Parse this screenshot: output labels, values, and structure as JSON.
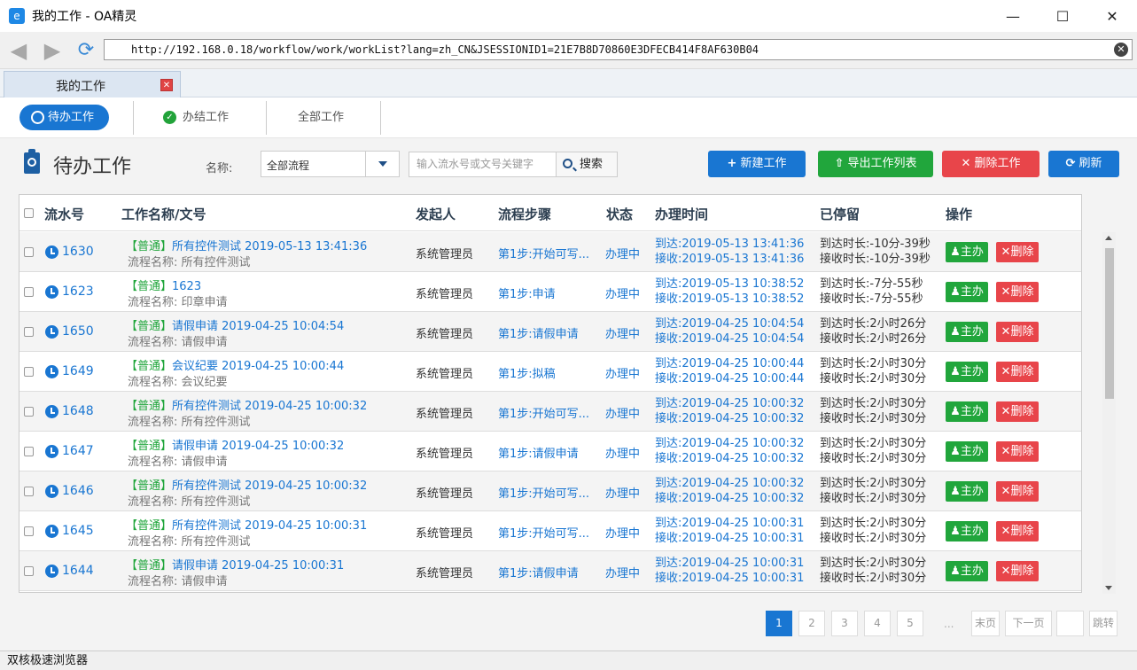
{
  "window": {
    "title": "我的工作 - OA精灵",
    "url": "http://192.168.0.18/workflow/work/workList?lang=zh_CN&JSESSIONID1=21E7B8D70860E3DFECB414F8AF630B04",
    "status_bar": "双核极速浏览器"
  },
  "doc_tab": {
    "label": "我的工作"
  },
  "subtabs": {
    "pending": "待办工作",
    "done": "办结工作",
    "all": "全部工作"
  },
  "toolbar": {
    "page_title": "待办工作",
    "name_label": "名称:",
    "flow_select_value": "全部流程",
    "search_placeholder": "输入流水号或文号关键字",
    "search_button": "搜索",
    "new_button": "新建工作",
    "export_button": "导出工作列表",
    "delete_button": "删除工作",
    "refresh_button": "刷新"
  },
  "table": {
    "headers": {
      "serial": "流水号",
      "name": "工作名称/文号",
      "sender": "发起人",
      "step": "流程步骤",
      "status": "状态",
      "time": "办理时间",
      "stay": "已停留",
      "ops": "操作"
    },
    "op_main": "主办",
    "op_delete": "删除",
    "rows": [
      {
        "num": "1630",
        "tag": "【普通】",
        "title": "所有控件测试 2019-05-13 13:41:36",
        "flow": "流程名称: 所有控件测试",
        "sender": "系统管理员",
        "step": "第1步:开始可写...",
        "status": "办理中",
        "arrive": "到达:2019-05-13 13:41:36",
        "receive": "接收:2019-05-13 13:41:36",
        "stay_arrive": "到达时长:-10分-39秒",
        "stay_receive": "接收时长:-10分-39秒"
      },
      {
        "num": "1623",
        "tag": "【普通】",
        "title": "1623",
        "flow": "流程名称: 印章申请",
        "sender": "系统管理员",
        "step": "第1步:申请",
        "status": "办理中",
        "arrive": "到达:2019-05-13 10:38:52",
        "receive": "接收:2019-05-13 10:38:52",
        "stay_arrive": "到达时长:-7分-55秒",
        "stay_receive": "接收时长:-7分-55秒"
      },
      {
        "num": "1650",
        "tag": "【普通】",
        "title": "请假申请 2019-04-25 10:04:54",
        "flow": "流程名称: 请假申请",
        "sender": "系统管理员",
        "step": "第1步:请假申请",
        "status": "办理中",
        "arrive": "到达:2019-04-25 10:04:54",
        "receive": "接收:2019-04-25 10:04:54",
        "stay_arrive": "到达时长:2小时26分",
        "stay_receive": "接收时长:2小时26分"
      },
      {
        "num": "1649",
        "tag": "【普通】",
        "title": "会议纪要 2019-04-25 10:00:44",
        "flow": "流程名称: 会议纪要",
        "sender": "系统管理员",
        "step": "第1步:拟稿",
        "status": "办理中",
        "arrive": "到达:2019-04-25 10:00:44",
        "receive": "接收:2019-04-25 10:00:44",
        "stay_arrive": "到达时长:2小时30分",
        "stay_receive": "接收时长:2小时30分"
      },
      {
        "num": "1648",
        "tag": "【普通】",
        "title": "所有控件测试 2019-04-25 10:00:32",
        "flow": "流程名称: 所有控件测试",
        "sender": "系统管理员",
        "step": "第1步:开始可写...",
        "status": "办理中",
        "arrive": "到达:2019-04-25 10:00:32",
        "receive": "接收:2019-04-25 10:00:32",
        "stay_arrive": "到达时长:2小时30分",
        "stay_receive": "接收时长:2小时30分"
      },
      {
        "num": "1647",
        "tag": "【普通】",
        "title": "请假申请 2019-04-25 10:00:32",
        "flow": "流程名称: 请假申请",
        "sender": "系统管理员",
        "step": "第1步:请假申请",
        "status": "办理中",
        "arrive": "到达:2019-04-25 10:00:32",
        "receive": "接收:2019-04-25 10:00:32",
        "stay_arrive": "到达时长:2小时30分",
        "stay_receive": "接收时长:2小时30分"
      },
      {
        "num": "1646",
        "tag": "【普通】",
        "title": "所有控件测试 2019-04-25 10:00:32",
        "flow": "流程名称: 所有控件测试",
        "sender": "系统管理员",
        "step": "第1步:开始可写...",
        "status": "办理中",
        "arrive": "到达:2019-04-25 10:00:32",
        "receive": "接收:2019-04-25 10:00:32",
        "stay_arrive": "到达时长:2小时30分",
        "stay_receive": "接收时长:2小时30分"
      },
      {
        "num": "1645",
        "tag": "【普通】",
        "title": "所有控件测试 2019-04-25 10:00:31",
        "flow": "流程名称: 所有控件测试",
        "sender": "系统管理员",
        "step": "第1步:开始可写...",
        "status": "办理中",
        "arrive": "到达:2019-04-25 10:00:31",
        "receive": "接收:2019-04-25 10:00:31",
        "stay_arrive": "到达时长:2小时30分",
        "stay_receive": "接收时长:2小时30分"
      },
      {
        "num": "1644",
        "tag": "【普通】",
        "title": "请假申请 2019-04-25 10:00:31",
        "flow": "流程名称: 请假申请",
        "sender": "系统管理员",
        "step": "第1步:请假申请",
        "status": "办理中",
        "arrive": "到达:2019-04-25 10:00:31",
        "receive": "接收:2019-04-25 10:00:31",
        "stay_arrive": "到达时长:2小时30分",
        "stay_receive": "接收时长:2小时30分"
      }
    ]
  },
  "pagination": {
    "pages": [
      "1",
      "2",
      "3",
      "4",
      "5"
    ],
    "current": "1",
    "ellipsis": "...",
    "last": "末页",
    "next": "下一页",
    "jump": "跳转"
  }
}
